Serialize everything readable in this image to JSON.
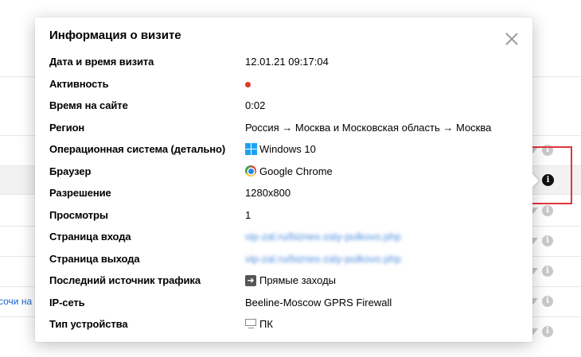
{
  "background": {
    "link_fragment": "сочи на"
  },
  "modal": {
    "title": "Информация о визите",
    "close_icon": "close-icon",
    "rows": [
      {
        "label": "Дата и время визита",
        "value": "12.01.21 09:17:04"
      },
      {
        "label": "Активность",
        "value": "",
        "indicator_color": "#e03a2a"
      },
      {
        "label": "Время на сайте",
        "value": "0:02"
      },
      {
        "label": "Регион",
        "value": "Россия → Москва и Московская область → Москва"
      },
      {
        "label": "Операционная система (детально)",
        "value": "Windows 10",
        "icon": "windows-icon"
      },
      {
        "label": "Браузер",
        "value": "Google Chrome",
        "icon": "chrome-icon"
      },
      {
        "label": "Разрешение",
        "value": "1280x800"
      },
      {
        "label": "Просмотры",
        "value": "1"
      },
      {
        "label": "Страница входа",
        "value": "vip-zal.ru/biznes-zaly-pulkovo.php"
      },
      {
        "label": "Страница выхода",
        "value": "vip-zal.ru/biznes-zaly-pulkovo.php"
      },
      {
        "label": "Последний источник трафика",
        "value": "Прямые заходы",
        "icon": "direct-traffic-icon"
      },
      {
        "label": "IP-сеть",
        "value": "Beeline-Moscow GPRS Firewall"
      },
      {
        "label": "Тип устройства",
        "value": "ПК",
        "icon": "desktop-icon"
      }
    ]
  },
  "colors": {
    "highlight_border": "#e0363b",
    "link": "#4b8bdf",
    "row_highlight": "#f2f2f2"
  }
}
